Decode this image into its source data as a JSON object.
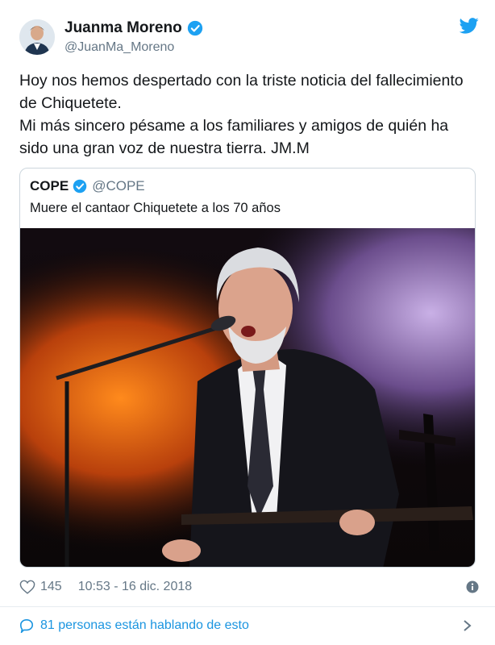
{
  "author": {
    "name": "Juanma Moreno",
    "handle": "@JuanMa_Moreno"
  },
  "tweet": {
    "line1": "Hoy nos hemos despertado con la triste noticia del fallecimiento de Chiquetete.",
    "line2": "Mi más sincero pésame a los familiares y amigos de quién ha sido una gran voz de nuestra tierra. JM.M"
  },
  "quoted": {
    "name": "COPE",
    "handle": "@COPE",
    "text": "Muere el cantaor Chiquetete a los 70 años"
  },
  "meta": {
    "likes": "145",
    "timestamp": "10:53 - 16 dic. 2018"
  },
  "footer": {
    "talking": "81 personas están hablando de esto"
  },
  "colors": {
    "accent": "#1da1f2",
    "link": "#1b95e0",
    "muted": "#657786"
  },
  "icons": [
    "verified-icon",
    "twitter-bird-icon",
    "heart-icon",
    "info-icon",
    "comment-bubble-icon",
    "chevron-right-icon"
  ]
}
